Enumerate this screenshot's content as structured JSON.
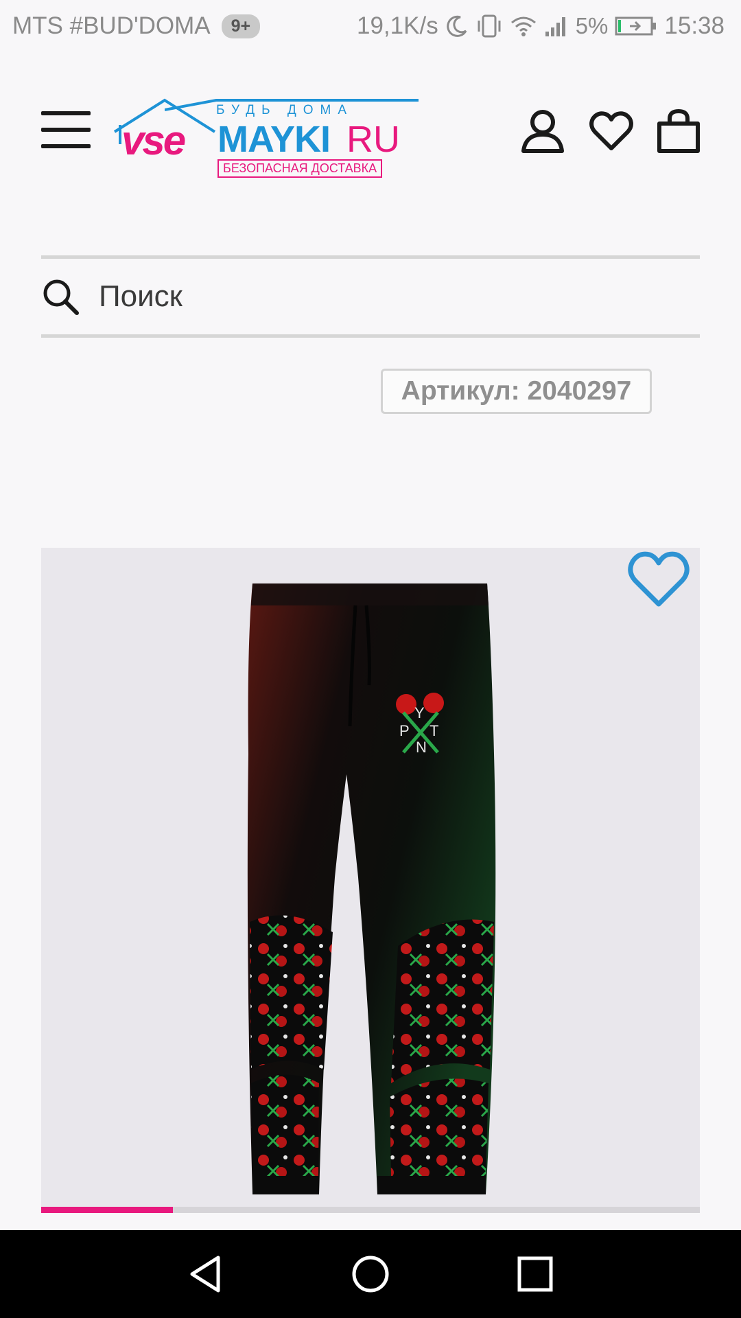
{
  "status_bar": {
    "carrier": "MTS #BUD'DOMA",
    "notification_count": "9+",
    "network_speed": "19,1K/s",
    "battery": "5%",
    "time": "15:38"
  },
  "header": {
    "logo": {
      "tagline": "БУДЬ ДОМА",
      "part_vse": "vse",
      "part_mayki": "MAYKI",
      "part_ru": "RU",
      "delivery": "БЕЗОПАСНАЯ ДОСТАВКА"
    },
    "icons": [
      "menu-icon",
      "user-icon",
      "heart-icon",
      "bag-icon"
    ]
  },
  "search": {
    "placeholder": "Поиск",
    "value": ""
  },
  "product": {
    "sku_label": "Артикул: 2040297",
    "image_alt": "pants",
    "gallery_progress": 0.2
  },
  "colors": {
    "brand_pink": "#e8197e",
    "brand_blue": "#1e93d6",
    "favorite_blue": "#2e93d3"
  }
}
